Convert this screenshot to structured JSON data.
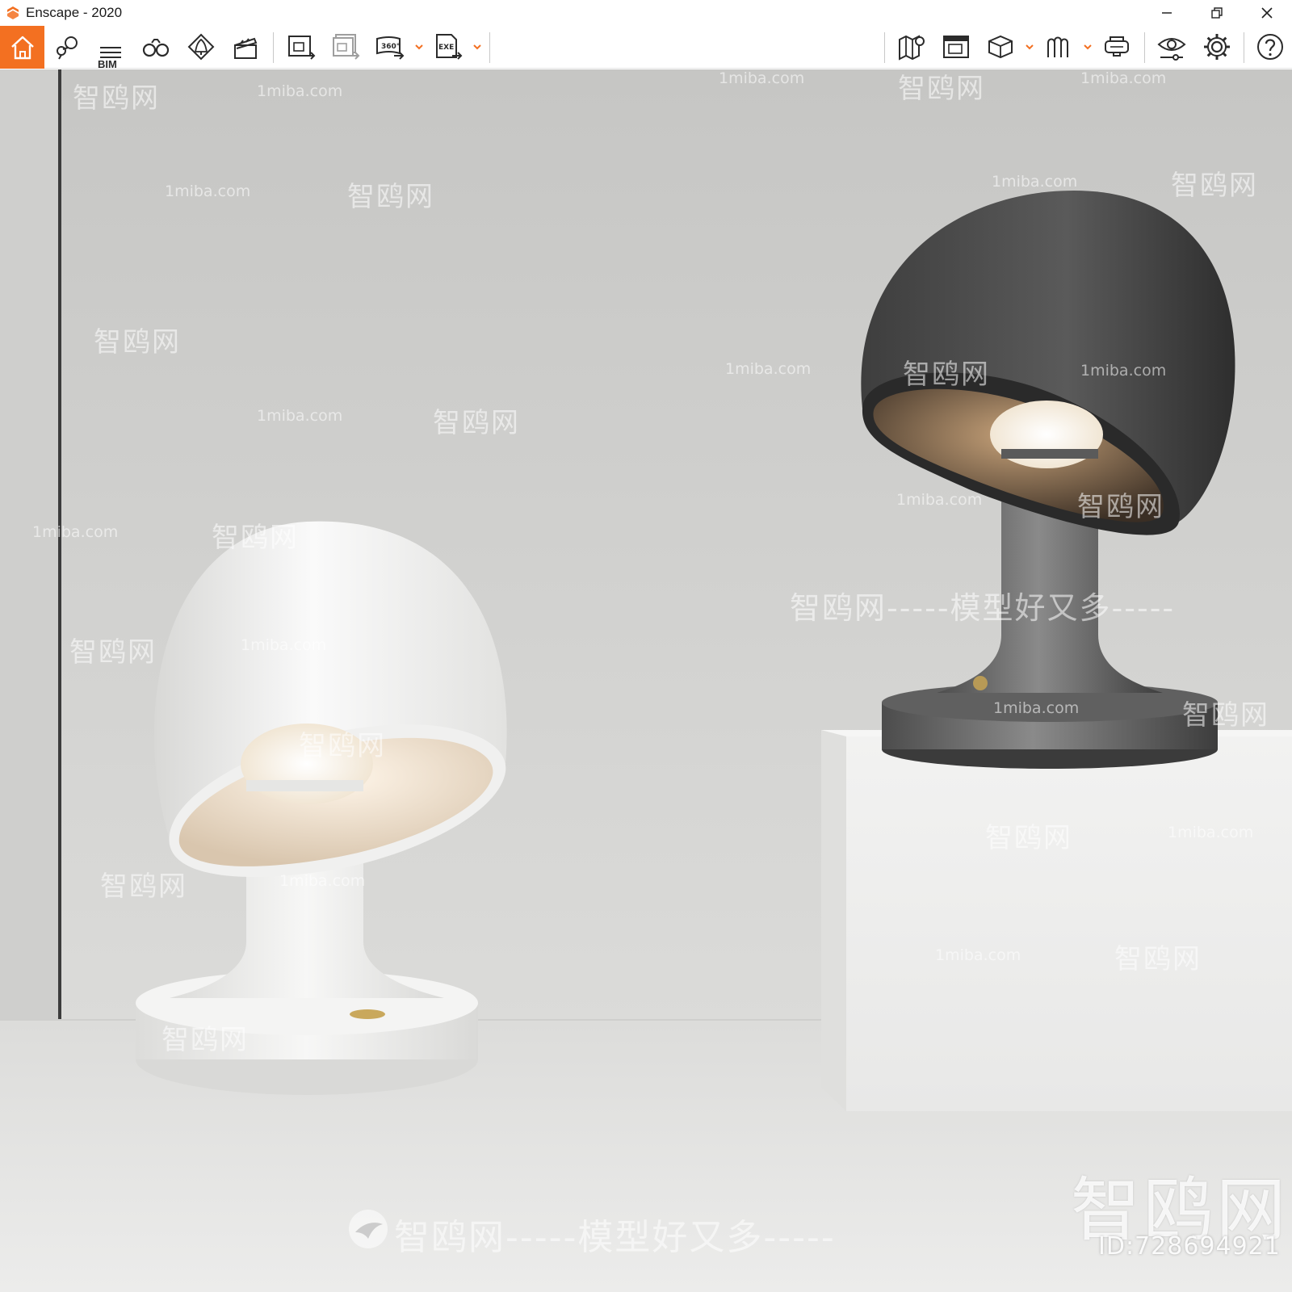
{
  "window": {
    "title": "Enscape - 2020",
    "controls": {
      "minimize": "–",
      "restore": "❐",
      "close": "✕"
    }
  },
  "toolbar": {
    "accent": "#f37021",
    "bim_label": "BIM",
    "items": [
      {
        "icon": "home-icon"
      },
      {
        "icon": "map-pin-icon"
      },
      {
        "icon": "bim-list-icon"
      },
      {
        "icon": "binoculars-icon"
      },
      {
        "icon": "light-bell-icon"
      },
      {
        "icon": "clapperboard-icon"
      },
      {
        "icon": "render-image-icon"
      },
      {
        "icon": "batch-render-icon"
      },
      {
        "icon": "panorama-360-icon"
      },
      {
        "icon": "export-exe-icon"
      },
      {
        "icon": "map-icon"
      },
      {
        "icon": "image-editor-icon"
      },
      {
        "icon": "asset-cube-icon"
      },
      {
        "icon": "material-editor-icon"
      },
      {
        "icon": "vr-headset-icon"
      },
      {
        "icon": "visual-settings-icon"
      },
      {
        "icon": "settings-gear-icon"
      },
      {
        "icon": "help-icon"
      }
    ],
    "badge_360": "360°",
    "badge_exe": "EXE"
  },
  "viewport": {
    "watermarks": {
      "site": "1miba.com",
      "brand": "智鸥网",
      "slogan": "智鸥网-----模型好又多-----",
      "big_logo": "智鸥网",
      "id": "ID:728694921"
    }
  }
}
